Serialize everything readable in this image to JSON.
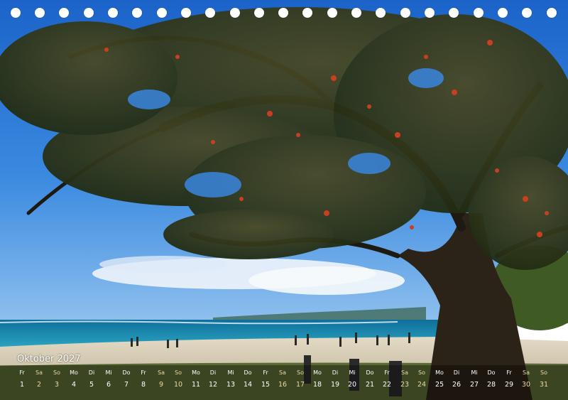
{
  "calendar": {
    "month_title": "Oktober 2027",
    "days": [
      {
        "wd": "Fr",
        "n": "1"
      },
      {
        "wd": "Sa",
        "n": "2"
      },
      {
        "wd": "So",
        "n": "3"
      },
      {
        "wd": "Mo",
        "n": "4"
      },
      {
        "wd": "Di",
        "n": "5"
      },
      {
        "wd": "Mi",
        "n": "6"
      },
      {
        "wd": "Do",
        "n": "7"
      },
      {
        "wd": "Fr",
        "n": "8"
      },
      {
        "wd": "Sa",
        "n": "9"
      },
      {
        "wd": "So",
        "n": "10"
      },
      {
        "wd": "Mo",
        "n": "11"
      },
      {
        "wd": "Di",
        "n": "12"
      },
      {
        "wd": "Mi",
        "n": "13"
      },
      {
        "wd": "Do",
        "n": "14"
      },
      {
        "wd": "Fr",
        "n": "15"
      },
      {
        "wd": "Sa",
        "n": "16"
      },
      {
        "wd": "So",
        "n": "17"
      },
      {
        "wd": "Mo",
        "n": "18"
      },
      {
        "wd": "Di",
        "n": "19"
      },
      {
        "wd": "Mi",
        "n": "20"
      },
      {
        "wd": "Do",
        "n": "21"
      },
      {
        "wd": "Fr",
        "n": "22"
      },
      {
        "wd": "Sa",
        "n": "23"
      },
      {
        "wd": "So",
        "n": "24"
      },
      {
        "wd": "Mo",
        "n": "25"
      },
      {
        "wd": "Di",
        "n": "26"
      },
      {
        "wd": "Mi",
        "n": "27"
      },
      {
        "wd": "Do",
        "n": "28"
      },
      {
        "wd": "Fr",
        "n": "29"
      },
      {
        "wd": "Sa",
        "n": "30"
      },
      {
        "wd": "So",
        "n": "31"
      }
    ],
    "weekend_color": "#e9d9a4",
    "text_color": "#ffffff"
  },
  "photo": {
    "subject": "tropical beach scene with large tree",
    "colors": {
      "sky": "#2d7fd8",
      "sea": "#1d8fb0",
      "sand": "#d9cfb8",
      "foliage": "#2f3a1c",
      "blossom": "#c8401f"
    }
  },
  "binding": {
    "hole_count": 23,
    "hole_color": "#ffffff"
  }
}
